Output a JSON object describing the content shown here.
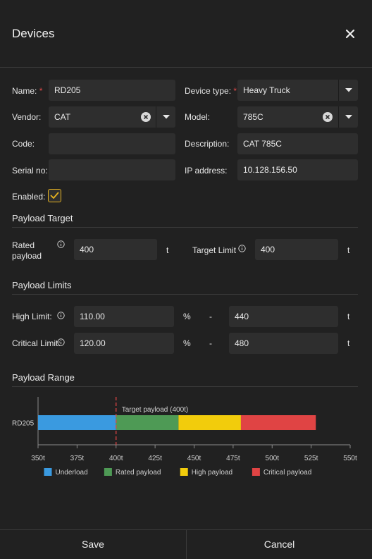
{
  "header": {
    "title": "Devices"
  },
  "form": {
    "name": {
      "label": "Name:",
      "value": "RD205"
    },
    "device_type": {
      "label": "Device type:",
      "value": "Heavy Truck"
    },
    "vendor": {
      "label": "Vendor:",
      "value": "CAT"
    },
    "model": {
      "label": "Model:",
      "value": "785C"
    },
    "code": {
      "label": "Code:",
      "value": ""
    },
    "description": {
      "label": "Description:",
      "value": "CAT 785C"
    },
    "serial_no": {
      "label": "Serial no:",
      "value": ""
    },
    "ip_address": {
      "label": "IP address:",
      "value": "10.128.156.50"
    },
    "enabled": {
      "label": "Enabled:",
      "checked": true
    },
    "required_mark": "*"
  },
  "payload_target": {
    "title": "Payload Target",
    "rated_payload_label_1": "Rated",
    "rated_payload_label_2": "payload",
    "rated_payload_value": "400",
    "rated_payload_unit": "t",
    "target_limit_label": "Target Limit",
    "target_limit_value": "400",
    "target_limit_unit": "t"
  },
  "payload_limits": {
    "title": "Payload Limits",
    "high_limit_label": "High Limit:",
    "high_limit_percent": "110.00",
    "high_limit_tonnes": "440",
    "critical_limit_label": "Critical Limit:",
    "critical_limit_percent": "120.00",
    "critical_limit_tonnes": "480",
    "percent_unit": "%",
    "dash": "-",
    "tonne_unit": "t"
  },
  "payload_range": {
    "title": "Payload Range"
  },
  "chart_data": {
    "type": "bar",
    "orientation": "horizontal-stacked",
    "categories": [
      "RD205"
    ],
    "xlim": [
      350,
      550
    ],
    "ticks": [
      350,
      375,
      400,
      425,
      450,
      475,
      500,
      525,
      550
    ],
    "tick_suffix": "t",
    "segments": [
      {
        "name": "Underload",
        "from": 350,
        "to": 400,
        "color": "#3a9ae0"
      },
      {
        "name": "Rated payload",
        "from": 400,
        "to": 440,
        "color": "#4e9a55"
      },
      {
        "name": "High payload",
        "from": 440,
        "to": 480,
        "color": "#f2cc0c"
      },
      {
        "name": "Critical payload",
        "from": 480,
        "to": 528,
        "color": "#e04444"
      }
    ],
    "target_line": {
      "value": 400,
      "label": "Target payload (400t)",
      "color": "#e04444"
    },
    "legend_position": "bottom"
  },
  "footer": {
    "save_label": "Save",
    "cancel_label": "Cancel"
  }
}
